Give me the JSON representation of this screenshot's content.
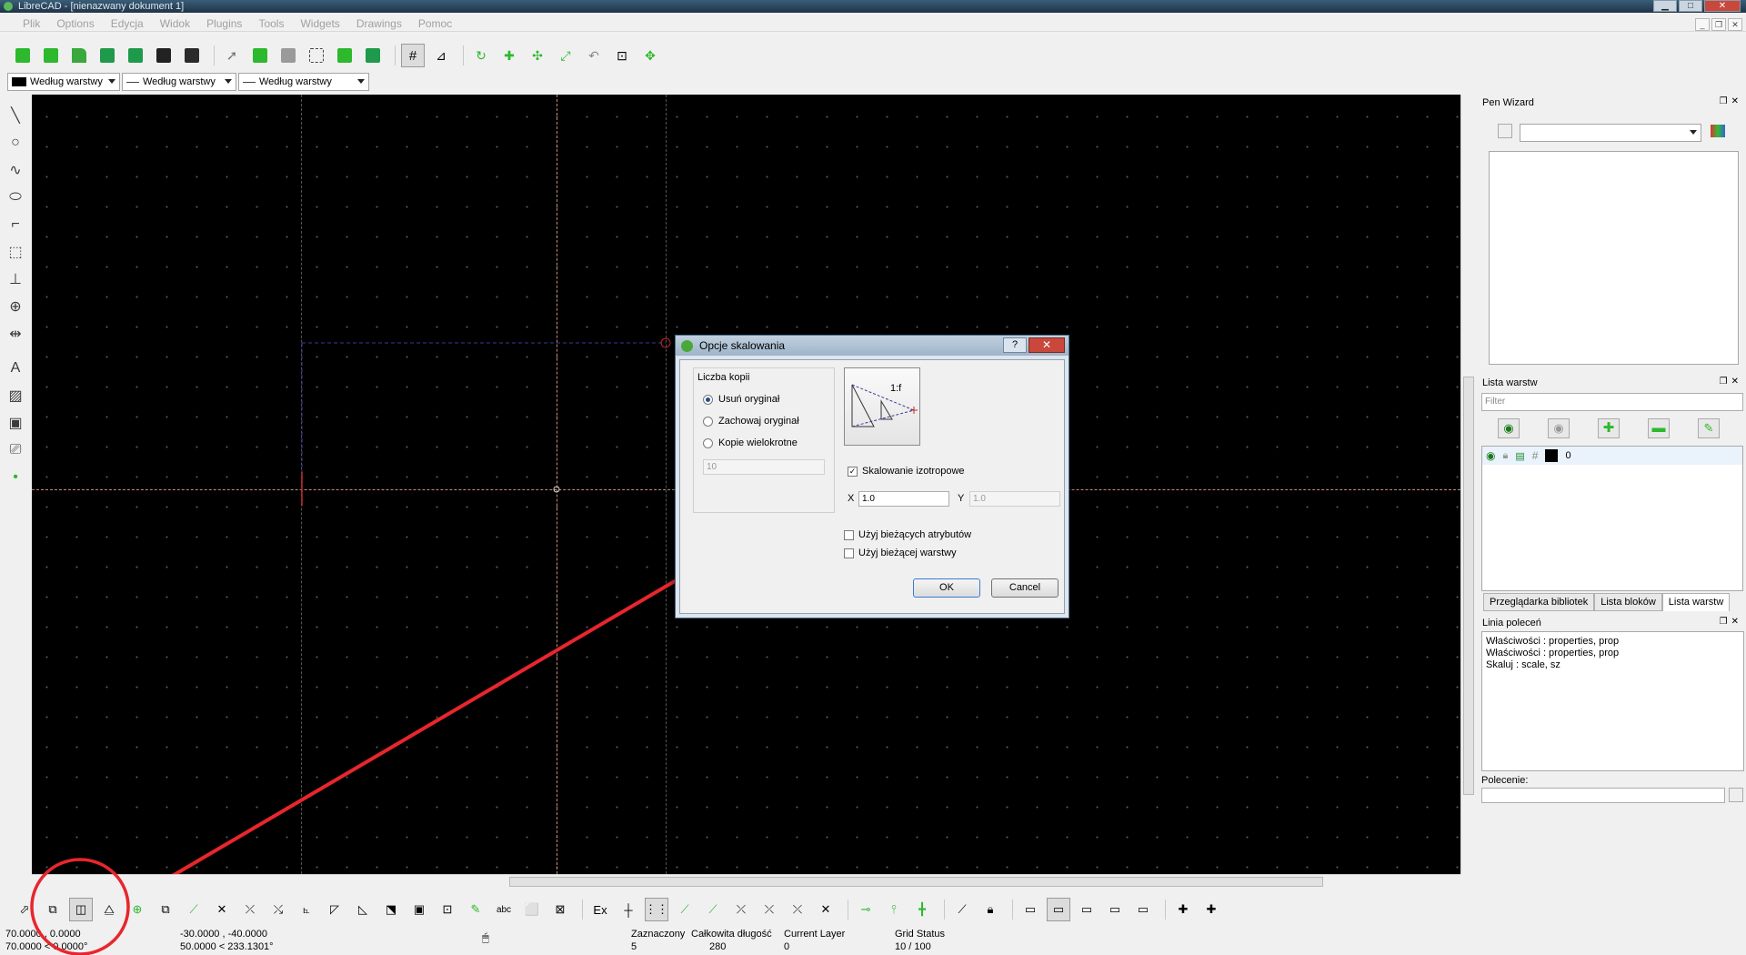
{
  "window": {
    "title": "LibreCAD - [nienazwany dokument 1]"
  },
  "menu": [
    "Plik",
    "Options",
    "Edycja",
    "Widok",
    "Plugins",
    "Tools",
    "Widgets",
    "Drawings",
    "Pomoc"
  ],
  "pen_toolbar": {
    "color": "Według warstwy",
    "width": "Według warstwy",
    "linetype": "Według warstwy"
  },
  "pen_wizard": {
    "title": "Pen Wizard"
  },
  "layer_list": {
    "title": "Lista warstw",
    "filter_placeholder": "Filter",
    "layers": [
      {
        "name": "0"
      }
    ]
  },
  "dock_tabs": [
    "Przeglądarka bibliotek",
    "Lista bloków",
    "Lista warstw"
  ],
  "command_line": {
    "title": "Linia poleceń",
    "history": [
      "Właściwości : properties, prop",
      "Właściwości : properties, prop",
      "Skaluj : scale, sz"
    ],
    "prompt": "Polecenie:"
  },
  "dialog": {
    "title": "Opcje skalowania",
    "group_title": "Liczba kopii",
    "options": [
      "Usuń oryginał",
      "Zachowaj oryginał",
      "Kopie wielokrotne"
    ],
    "selected_option": 0,
    "copies_value": "10",
    "preview_label": "1:f",
    "isotropic_label": "Skalowanie izotropowe",
    "x_label": "X",
    "x_value": "1.0",
    "y_label": "Y",
    "y_value": "1.0",
    "use_current_attributes": "Użyj bieżących atrybutów",
    "use_current_layer": "Użyj bieżącej warstwy",
    "ok": "OK",
    "cancel": "Cancel"
  },
  "snap_bar": {
    "ex_label": "Ex"
  },
  "status": {
    "abs_coord_1": "70.0000 , 0.0000",
    "abs_coord_2": "70.0000 < 0.0000°",
    "rel_coord_1": "-30.0000 , -40.0000",
    "rel_coord_2": "50.0000 < 233.1301°",
    "selected_label": "Zaznaczony",
    "selected_value": "5",
    "total_length_label": "Całkowita długość",
    "total_length_value": "280",
    "current_layer_label": "Current Layer",
    "current_layer_value": "0",
    "grid_status_label": "Grid Status",
    "grid_status_value": "10 / 100"
  },
  "colors": {
    "annotation_red": "#e8262d",
    "canvas_bg": "#000000",
    "icon_green": "#2db82d"
  }
}
